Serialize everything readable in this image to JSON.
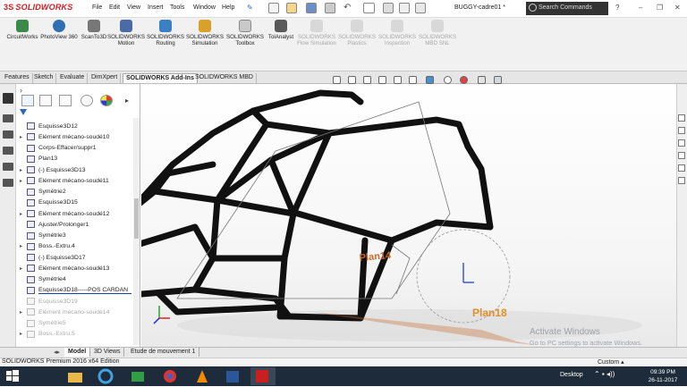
{
  "app": {
    "brand": "SOLIDWORKS",
    "brand_prefix": "3S"
  },
  "menu": [
    "File",
    "Edit",
    "View",
    "Insert",
    "Tools",
    "Window",
    "Help"
  ],
  "document_title": "BUGGY-cadre01 *",
  "search": {
    "placeholder": "Search Commands"
  },
  "window_buttons": {
    "minimize": "–",
    "restore": "❐",
    "close": "✕"
  },
  "commands": [
    {
      "label": "CircuitWorks",
      "icon": "circuitworks-icon",
      "enabled": true
    },
    {
      "label": "PhotoView 360",
      "icon": "photoview-icon",
      "enabled": true
    },
    {
      "label": "ScanTo3D",
      "icon": "scanto3d-icon",
      "enabled": true
    },
    {
      "label": "SOLIDWORKS Motion",
      "icon": "motion-icon",
      "enabled": true
    },
    {
      "label": "SOLIDWORKS Routing",
      "icon": "routing-icon",
      "enabled": true
    },
    {
      "label": "SOLIDWORKS Simulation",
      "icon": "simulation-icon",
      "enabled": true
    },
    {
      "label": "SOLIDWORKS Toolbox",
      "icon": "toolbox-icon",
      "enabled": true
    },
    {
      "label": "TolAnalyst",
      "icon": "tolanalyst-icon",
      "enabled": true
    },
    {
      "label": "SOLIDWORKS Flow Simulation",
      "icon": "flow-icon",
      "enabled": false
    },
    {
      "label": "SOLIDWORKS Plastics",
      "icon": "plastics-icon",
      "enabled": false
    },
    {
      "label": "SOLIDWORKS Inspection",
      "icon": "inspection-icon",
      "enabled": false
    },
    {
      "label": "SOLIDWORKS MBD SNL",
      "icon": "mbd-icon",
      "enabled": false
    }
  ],
  "ribbon_tabs": [
    "Features",
    "Sketch",
    "Evaluate",
    "DimXpert",
    "SOLIDWORKS Add-Ins",
    "SOLIDWORKS MBD"
  ],
  "active_ribbon_tab": "SOLIDWORKS Add-Ins",
  "feature_tree": [
    {
      "label": "Esquisse3D12",
      "type": "sketch3d",
      "expandable": false,
      "suppressed": false
    },
    {
      "label": "Elément mécano-soudé10",
      "type": "weldment",
      "expandable": true,
      "suppressed": false
    },
    {
      "label": "Corps-Effacer/suppr1",
      "type": "delete-body",
      "expandable": false,
      "suppressed": false
    },
    {
      "label": "Plan13",
      "type": "plane",
      "expandable": false,
      "suppressed": false
    },
    {
      "label": "(-) Esquisse3D13",
      "type": "sketch3d",
      "expandable": true,
      "suppressed": false
    },
    {
      "label": "Elément mécano-soudé11",
      "type": "weldment",
      "expandable": true,
      "suppressed": false
    },
    {
      "label": "Symétrie2",
      "type": "mirror",
      "expandable": false,
      "suppressed": false
    },
    {
      "label": "Esquisse3D15",
      "type": "sketch3d",
      "expandable": false,
      "suppressed": false
    },
    {
      "label": "Elément mécano-soudé12",
      "type": "weldment",
      "expandable": true,
      "suppressed": false
    },
    {
      "label": "Ajuster/Prolonger1",
      "type": "trim",
      "expandable": false,
      "suppressed": false
    },
    {
      "label": "Symétrie3",
      "type": "mirror",
      "expandable": false,
      "suppressed": false
    },
    {
      "label": "Boss.-Extru.4",
      "type": "extrude",
      "expandable": true,
      "suppressed": false
    },
    {
      "label": "(-) Esquisse3D17",
      "type": "sketch3d",
      "expandable": false,
      "suppressed": false
    },
    {
      "label": "Elément mécano-soudé13",
      "type": "weldment",
      "expandable": true,
      "suppressed": false
    },
    {
      "label": "Symétrie4",
      "type": "mirror",
      "expandable": false,
      "suppressed": false
    },
    {
      "label": "Esquisse3D18-----POS CARDAN",
      "type": "sketch3d",
      "expandable": false,
      "suppressed": false,
      "selected": true
    },
    {
      "label": "Esquisse3D19",
      "type": "sketch3d",
      "expandable": false,
      "suppressed": true
    },
    {
      "label": "Elément mécano-soudé14",
      "type": "weldment",
      "expandable": true,
      "suppressed": true
    },
    {
      "label": "Symétrie5",
      "type": "mirror",
      "expandable": false,
      "suppressed": true
    },
    {
      "label": "Boss.-Extru.5",
      "type": "extrude",
      "expandable": true,
      "suppressed": true
    }
  ],
  "viewport": {
    "plane_labels": [
      "Plan14",
      "Plan18"
    ],
    "triad_labels": [
      "Y",
      "X"
    ]
  },
  "bottom_tabs": [
    "Model",
    "3D Views",
    "Etude de mouvement 1"
  ],
  "active_bottom_tab": "Model",
  "status": {
    "text": "SOLIDWORKS Premium 2016 x64 Edition",
    "units": "Custom"
  },
  "watermark": {
    "title": "Activate Windows",
    "subtitle": "Go to PC settings to activate Windows."
  },
  "taskbar": {
    "desktop_label": "Desktop",
    "time": "09:39 PM",
    "date": "26-11-2017",
    "apps": [
      "windows-start-icon",
      "folder-icon",
      "ie-icon",
      "store-icon",
      "chrome-icon",
      "vlc-icon",
      "word-icon",
      "solidworks-app-icon"
    ]
  },
  "colors": {
    "brand_red": "#d71920",
    "plane_label": "#c96a2a",
    "selection_blue": "#1a3fb0",
    "taskbar": "#1e2b3a"
  }
}
